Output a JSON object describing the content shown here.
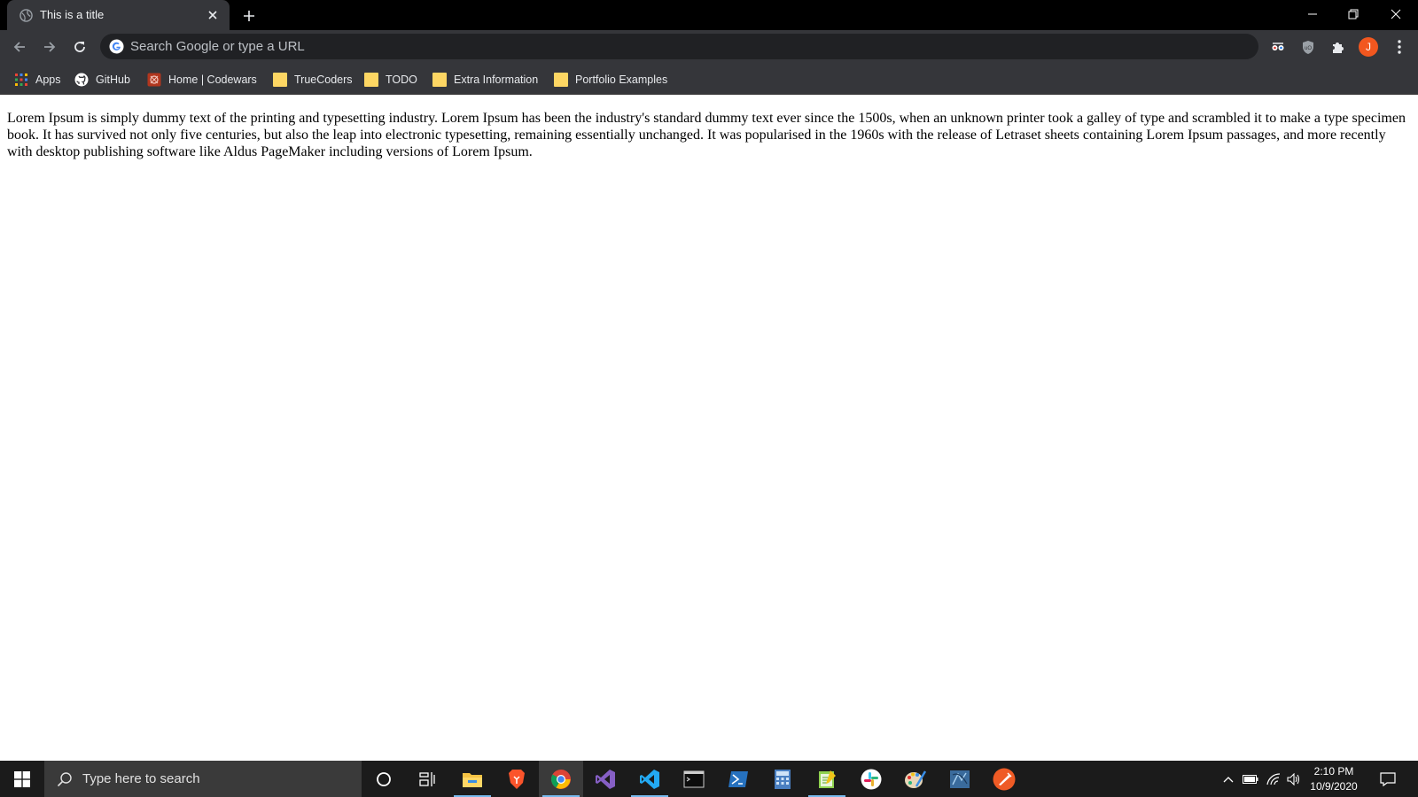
{
  "browser": {
    "tab": {
      "title": "This is a title",
      "favicon": "globe-icon"
    },
    "new_tab_label": "+",
    "window_controls": [
      "minimize-icon",
      "restore-icon",
      "close-icon"
    ]
  },
  "toolbar": {
    "omnibox_placeholder": "Search Google or type a URL",
    "avatar_initial": "J",
    "avatar_color": "#f2571f",
    "extensions": [
      "glasses-extension-icon",
      "shield-extension-icon",
      "puzzle-icon"
    ]
  },
  "bookmarks": [
    {
      "label": "Apps",
      "icon": "apps-grid-icon"
    },
    {
      "label": "GitHub",
      "icon": "github-icon"
    },
    {
      "label": "Home | Codewars",
      "icon": "codewars-icon"
    },
    {
      "label": "TrueCoders",
      "icon": "folder-icon"
    },
    {
      "label": "TODO",
      "icon": "folder-icon"
    },
    {
      "label": "Extra Information",
      "icon": "folder-icon"
    },
    {
      "label": "Portfolio Examples",
      "icon": "folder-icon"
    }
  ],
  "page": {
    "paragraph": "Lorem Ipsum is simply dummy text of the printing and typesetting industry. Lorem Ipsum has been the industry's standard dummy text ever since the 1500s, when an unknown printer took a galley of type and scrambled it to make a type specimen book. It has survived not only five centuries, but also the leap into electronic typesetting, remaining essentially unchanged. It was popularised in the 1960s with the release of Letraset sheets containing Lorem Ipsum passages, and more recently with desktop publishing software like Aldus PageMaker including versions of Lorem Ipsum."
  },
  "taskbar": {
    "search_placeholder": "Type here to search",
    "apps": [
      "cortana-icon",
      "task-view-icon",
      "file-explorer-icon",
      "brave-icon",
      "chrome-icon",
      "visual-studio-icon",
      "vscode-icon",
      "terminal-icon",
      "powershell-icon",
      "calculator-icon",
      "notepad-icon",
      "slack-icon",
      "paint-icon",
      "sql-icon",
      "postman-icon"
    ],
    "time": "2:10 PM",
    "date": "10/9/2020"
  }
}
